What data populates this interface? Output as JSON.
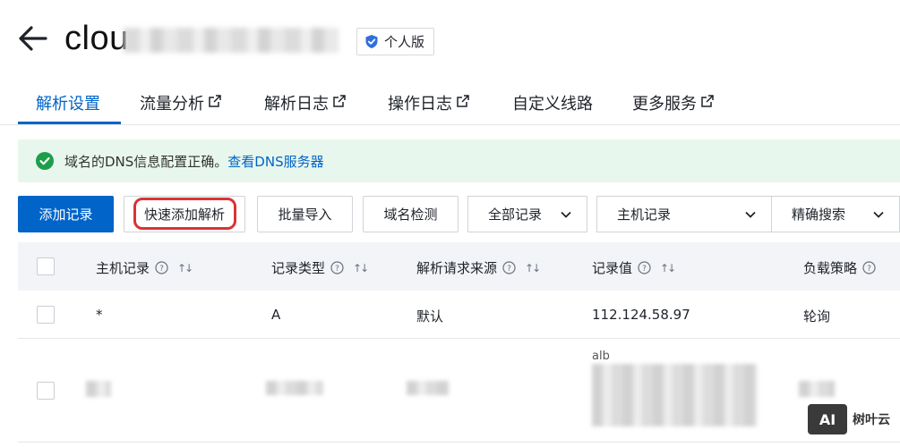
{
  "header": {
    "domain_prefix": "clou",
    "edition_badge": "个人版"
  },
  "tabs": [
    {
      "label": "解析设置",
      "active": true
    },
    {
      "label": "流量分析",
      "external": true
    },
    {
      "label": "解析日志",
      "external": true
    },
    {
      "label": "操作日志",
      "external": true
    },
    {
      "label": "自定义线路"
    },
    {
      "label": "更多服务",
      "external": true
    }
  ],
  "alert": {
    "text": "域名的DNS信息配置正确。",
    "link": "查看DNS服务器"
  },
  "toolbar": {
    "add_record": "添加记录",
    "quick_add": "快速添加解析",
    "batch_import": "批量导入",
    "domain_check": "域名检测",
    "filter_all": "全部记录",
    "filter_host": "主机记录",
    "search_mode": "精确搜索"
  },
  "table": {
    "columns": [
      "主机记录",
      "记录类型",
      "解析请求来源",
      "记录值",
      "负载策略"
    ],
    "rows": [
      {
        "host": "*",
        "type": "A",
        "source": "默认",
        "value": "112.124.58.97",
        "policy": "轮询"
      },
      {
        "value_partial": "alb"
      }
    ]
  },
  "watermark": {
    "logo": "AI",
    "text": "树叶云"
  },
  "colors": {
    "primary": "#0064c8",
    "success": "#1e9e4b",
    "alert_bg": "#e8f7ed",
    "highlight_ring": "#d93333"
  }
}
